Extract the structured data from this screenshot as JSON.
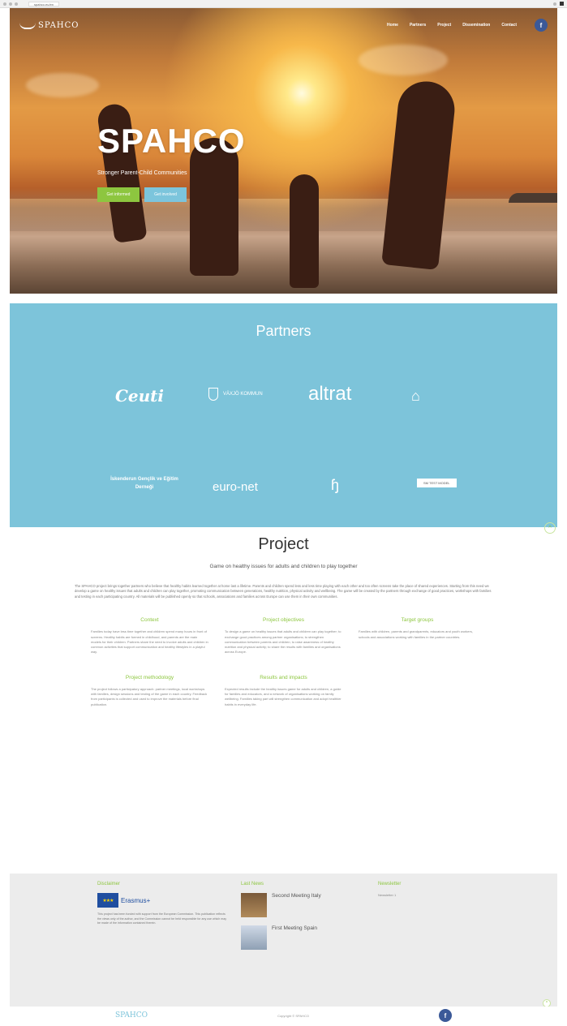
{
  "browser": {
    "url": "spahco.eu/en"
  },
  "nav": {
    "logo": "SPAHCO",
    "links": [
      "Home",
      "Partners",
      "Project",
      "Dissemination",
      "Contact"
    ],
    "facebook_icon": "f"
  },
  "hero": {
    "title": "SPAHCO",
    "subtitle": "Stronger Parent-Child Communities",
    "btn1": "Get informed",
    "btn2": "Get involved"
  },
  "partners": {
    "title": "Partners",
    "logos": {
      "ceuti": "Ceuti",
      "vaxjo": "VÄXJÖ KOMMUN",
      "altrat": "altrat",
      "genclik": "İskenderun Gençlik ve Eğitim Derneği",
      "euronet": "euro-net",
      "badge": "SM TEST MODEL"
    }
  },
  "project": {
    "title": "Project",
    "subtitle": "Game on healthy issues for adults and children to play together",
    "intro": "The SPAHCO project brings together partners who believe that healthy habits learned together at home last a lifetime. Parents and children spend less and less time playing with each other and too often screens take the place of shared experiences. Starting from this need we develop a game on healthy issues that adults and children can play together, promoting communication between generations, healthy nutrition, physical activity and wellbeing. The game will be created by the partners through exchange of good practices, workshops with families and testing in each participating country. All materials will be published openly so that schools, associations and families across Europe can use them in their own communities.",
    "columns": [
      {
        "title": "Context",
        "text": "Families today have less time together and children spend many hours in front of screens. Healthy habits are formed in childhood, and parents are the main models for their children. Partners share the need to involve adults and children in common activities that support communication and healthy lifestyles in a playful way."
      },
      {
        "title": "Project objectives",
        "text": "To design a game on healthy issues that adults and children can play together; to exchange good practices among partner organisations; to strengthen communication between parents and children; to raise awareness of healthy nutrition and physical activity; to share the results with families and organisations across Europe."
      },
      {
        "title": "Target groups",
        "text": "Families with children, parents and grandparents, educators and youth workers, schools and associations working with families in the partner countries."
      }
    ],
    "columns2": [
      {
        "title": "Project methodology",
        "text": "The project follows a participatory approach: partner meetings, local workshops with families, design sessions and testing of the game in each country. Feedback from participants is collected and used to improve the materials before final publication."
      },
      {
        "title": "Results and impacts",
        "text": "Expected results include the healthy issues game for adults and children, a guide for families and educators, and a network of organisations working on family wellbeing. Families taking part will strengthen communication and adopt healthier habits in everyday life."
      }
    ]
  },
  "footer": {
    "col1_title": "Disclaimer",
    "erasmus": "Erasmus+",
    "disclaimer": "This project has been funded with support from the European Commission. This publication reflects the views only of the author, and the Commission cannot be held responsible for any use which may be made of the information contained therein.",
    "col2_title": "Last News",
    "news": [
      {
        "title": "Second Meeting Italy",
        "date": ""
      },
      {
        "title": "First Meeting Spain",
        "date": ""
      }
    ],
    "col3_title": "Newsletter",
    "newsletter_item": "Newsletter 1"
  },
  "bottom": {
    "logo": "SPAHCO",
    "copyright": "Copyright © SPAHCO",
    "facebook_icon": "f"
  }
}
